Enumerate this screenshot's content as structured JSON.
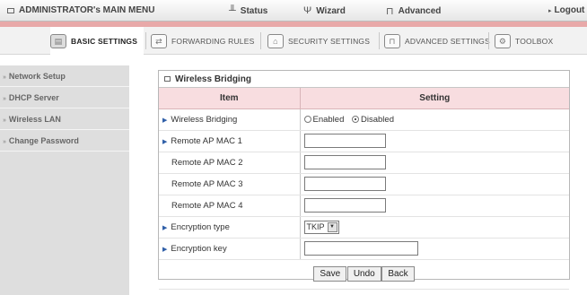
{
  "topbar": {
    "menu_title": "ADMINISTRATOR's MAIN MENU",
    "status": "Status",
    "wizard": "Wizard",
    "advanced": "Advanced",
    "logout": "Logout"
  },
  "tabs": [
    {
      "label": "BASIC SETTINGS",
      "icon": "folder-icon"
    },
    {
      "label": "FORWARDING RULES",
      "icon": "forward-icon"
    },
    {
      "label": "SECURITY SETTINGS",
      "icon": "security-icon"
    },
    {
      "label": "ADVANCED SETTINGS",
      "icon": "advanced-icon"
    },
    {
      "label": "TOOLBOX",
      "icon": "toolbox-icon"
    }
  ],
  "sidebar": {
    "items": [
      {
        "label": "Network Setup"
      },
      {
        "label": "DHCP Server"
      },
      {
        "label": "Wireless LAN"
      },
      {
        "label": "Change Password"
      }
    ]
  },
  "panel": {
    "title": "Wireless Bridging",
    "col_item": "Item",
    "col_setting": "Setting",
    "rows": {
      "bridging": {
        "label": "Wireless Bridging",
        "enabled": "Enabled",
        "disabled": "Disabled",
        "selected": "Disabled"
      },
      "mac1": {
        "label": "Remote AP MAC 1",
        "value": ""
      },
      "mac2": {
        "label": "Remote AP MAC 2",
        "value": ""
      },
      "mac3": {
        "label": "Remote AP MAC 3",
        "value": ""
      },
      "mac4": {
        "label": "Remote AP MAC 4",
        "value": ""
      },
      "enc_type": {
        "label": "Encryption type",
        "value": "TKIP"
      },
      "enc_key": {
        "label": "Encryption key",
        "value": ""
      }
    },
    "buttons": {
      "save": "Save",
      "undo": "Undo",
      "back": "Back"
    }
  }
}
